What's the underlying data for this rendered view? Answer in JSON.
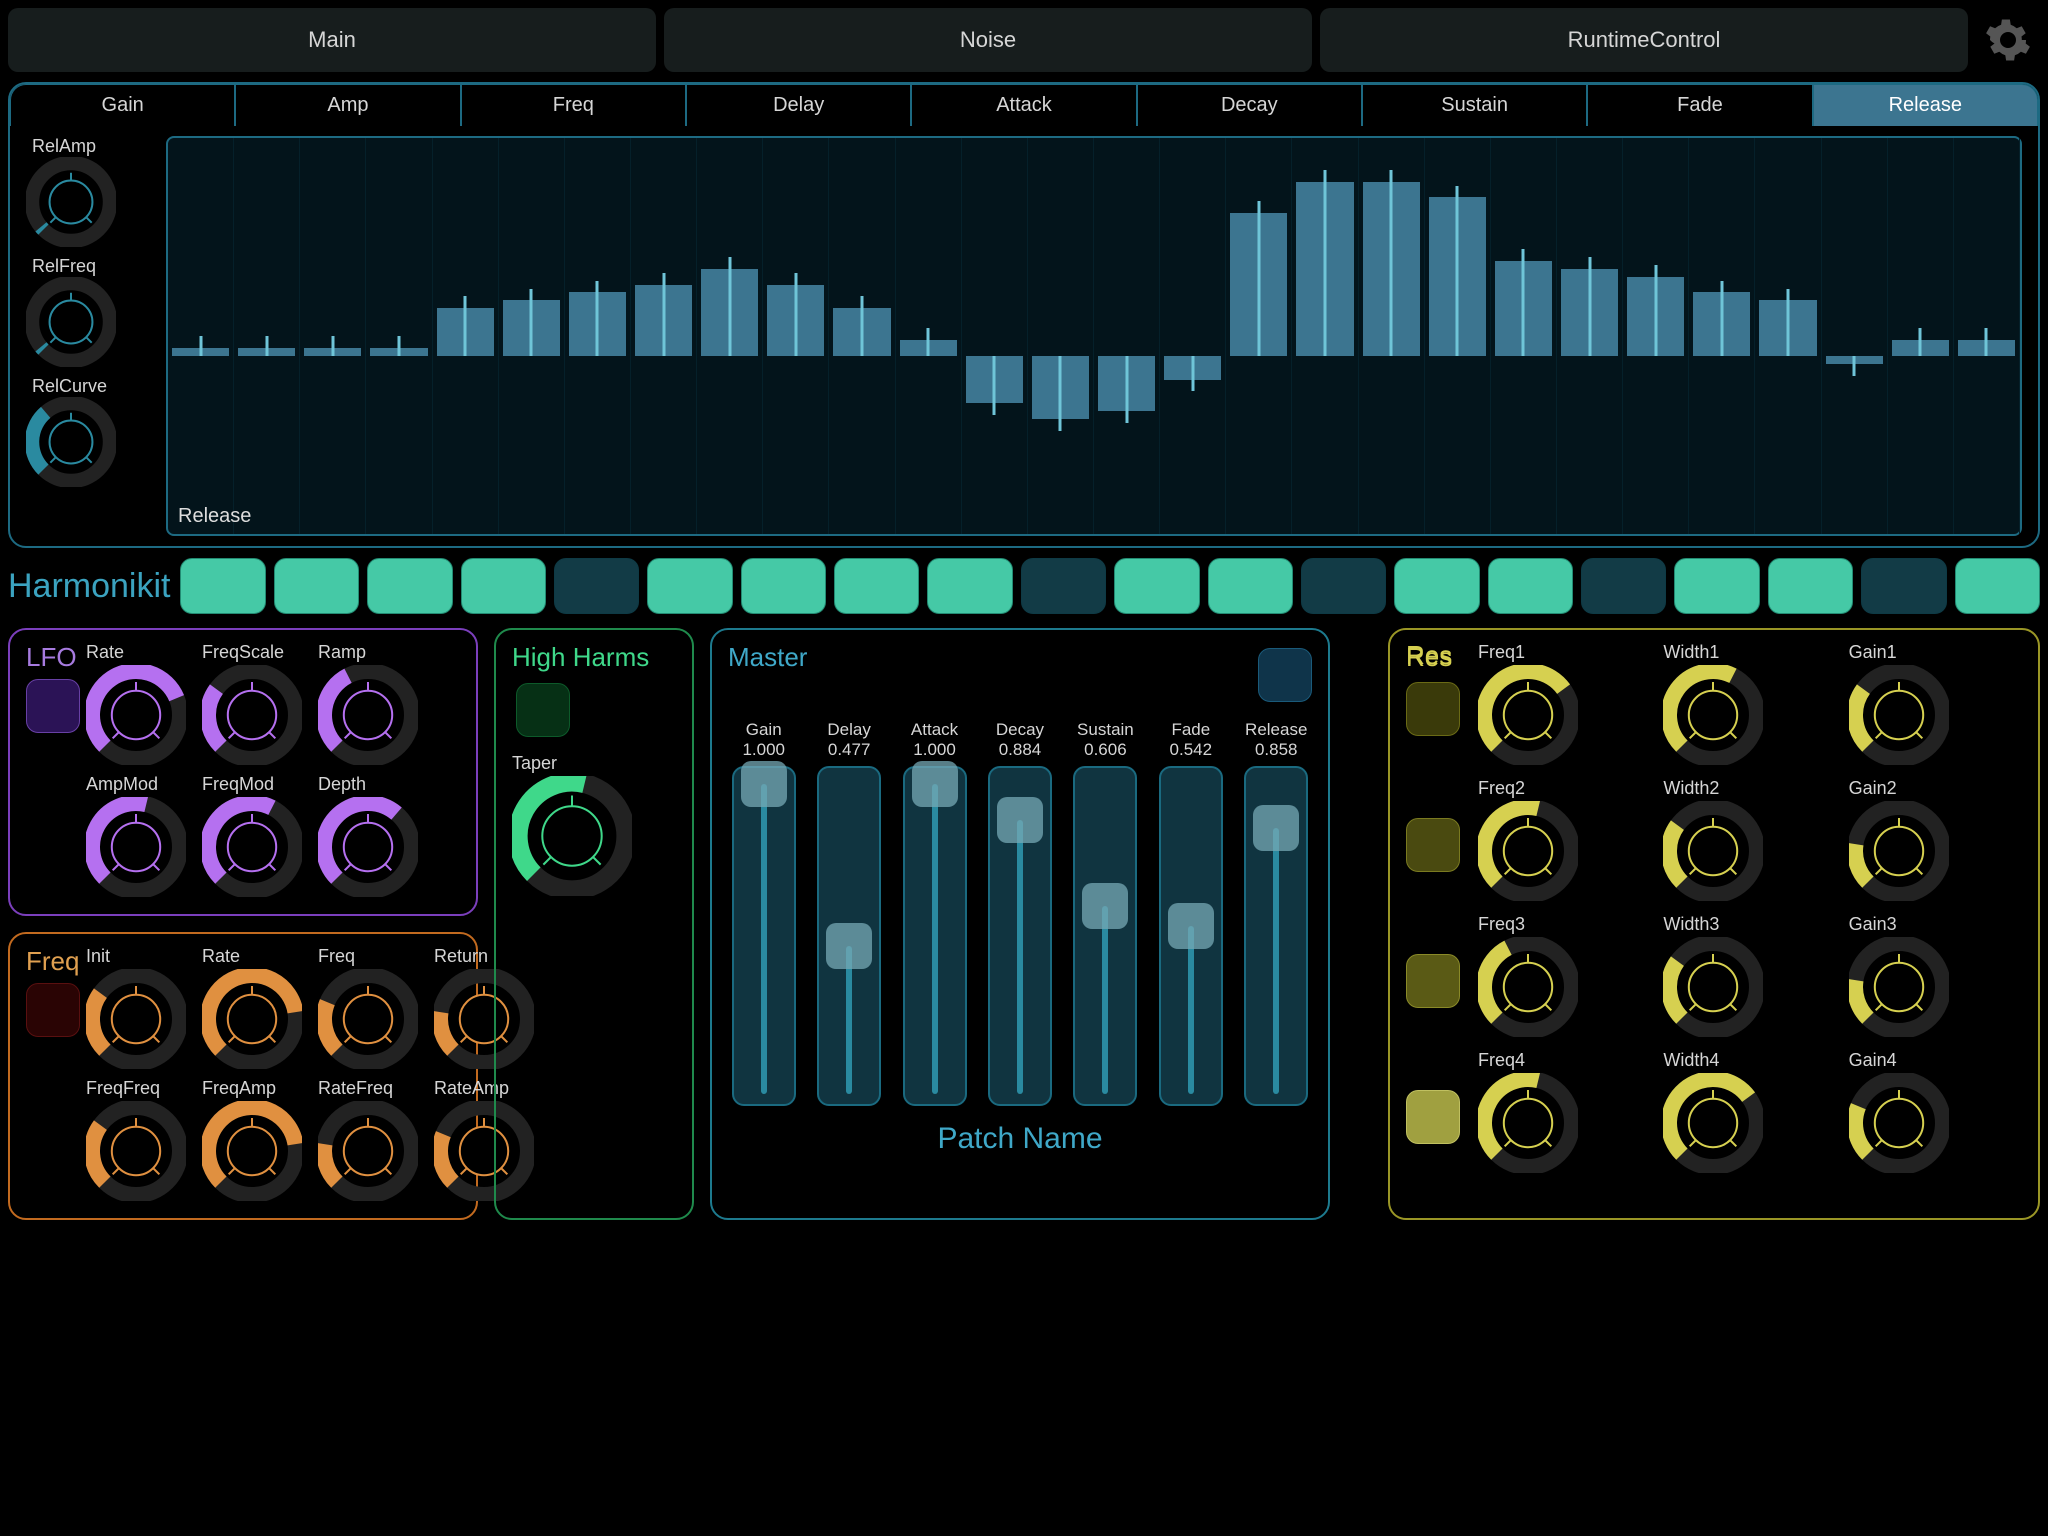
{
  "top_tabs": [
    "Main",
    "Noise",
    "RuntimeControl"
  ],
  "sub_tabs": [
    "Gain",
    "Amp",
    "Freq",
    "Delay",
    "Attack",
    "Decay",
    "Sustain",
    "Fade",
    "Release"
  ],
  "sub_active": 8,
  "rel_knobs": [
    "RelAmp",
    "RelFreq",
    "RelCurve"
  ],
  "graph_label": "Release",
  "graph_bars_pct": [
    2,
    2,
    2,
    2,
    12,
    14,
    16,
    18,
    22,
    18,
    12,
    4,
    -12,
    -16,
    -14,
    -6,
    36,
    44,
    44,
    40,
    24,
    22,
    20,
    16,
    14,
    -2,
    4,
    4
  ],
  "app_title": "Harmonikit",
  "steps": [
    true,
    true,
    true,
    true,
    false,
    true,
    true,
    true,
    true,
    false,
    true,
    true,
    false,
    true,
    true,
    false,
    true,
    true,
    false,
    true
  ],
  "lfo": {
    "title": "LFO",
    "knobs": [
      "Rate",
      "FreqScale",
      "Ramp",
      "AmpMod",
      "FreqMod",
      "Depth"
    ],
    "vals": [
      0.75,
      0.3,
      0.4,
      0.55,
      0.6,
      0.65
    ]
  },
  "freq": {
    "title": "Freq",
    "knobs": [
      "Init",
      "Rate",
      "Freq",
      "Return",
      "FreqFreq",
      "FreqAmp",
      "RateFreq",
      "RateAmp"
    ],
    "vals": [
      0.3,
      0.8,
      0.25,
      0.2,
      0.3,
      0.8,
      0.2,
      0.25
    ]
  },
  "hh": {
    "title": "High Harms",
    "taper_label": "Taper",
    "taper_val": 0.55
  },
  "master": {
    "title": "Master",
    "sliders": [
      {
        "label": "Gain",
        "val": "1.000",
        "v": 1.0
      },
      {
        "label": "Delay",
        "val": "0.477",
        "v": 0.477
      },
      {
        "label": "Attack",
        "val": "1.000",
        "v": 1.0
      },
      {
        "label": "Decay",
        "val": "0.884",
        "v": 0.884
      },
      {
        "label": "Sustain",
        "val": "0.606",
        "v": 0.606
      },
      {
        "label": "Fade",
        "val": "0.542",
        "v": 0.542
      },
      {
        "label": "Release",
        "val": "0.858",
        "v": 0.858
      }
    ],
    "patch_name": "Patch Name"
  },
  "res": {
    "title": "Res",
    "rows": [
      {
        "labels": [
          "Freq1",
          "Width1",
          "Gain1"
        ],
        "vals": [
          0.7,
          0.6,
          0.3
        ]
      },
      {
        "labels": [
          "Freq2",
          "Width2",
          "Gain2"
        ],
        "vals": [
          0.55,
          0.3,
          0.2
        ]
      },
      {
        "labels": [
          "Freq3",
          "Width3",
          "Gain3"
        ],
        "vals": [
          0.4,
          0.3,
          0.2
        ]
      },
      {
        "labels": [
          "Freq4",
          "Width4",
          "Gain4"
        ],
        "vals": [
          0.55,
          0.7,
          0.25
        ]
      }
    ]
  }
}
